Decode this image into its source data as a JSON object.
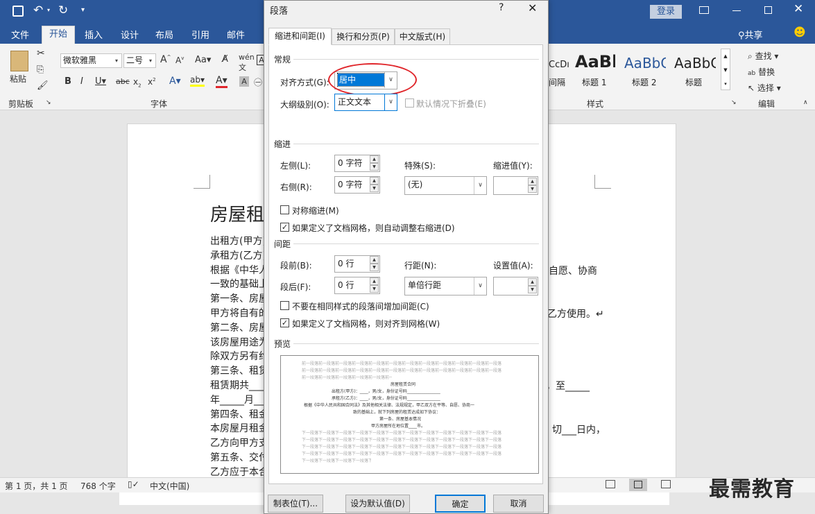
{
  "titlebar": {
    "login": "登录"
  },
  "ribbon_tabs": [
    "文件",
    "开始",
    "插入",
    "设计",
    "布局",
    "引用",
    "邮件"
  ],
  "share": "共享",
  "ribbon": {
    "paste": "粘贴",
    "font_name": "微软雅黑",
    "font_size": "二号",
    "clipboard_group": "剪贴板",
    "font_group": "字体",
    "styles_group": "样式",
    "editing_group": "编辑",
    "styles": [
      {
        "sample": "AaBl",
        "label": "标题 1"
      },
      {
        "sample": "AaBbC",
        "label": "标题 2"
      },
      {
        "sample": "AaBbC",
        "label": "标题"
      }
    ],
    "style_prefix": "CcDı",
    "style_prefix_label": "间隔",
    "find": "查找",
    "replace": "替换",
    "select": "选择"
  },
  "document": {
    "title": "房屋租",
    "lines": [
      "出租方(甲方)",
      "承租方(乙方)",
      "根据《中华人",
      "一致的基础上",
      "第一条、房屋",
      "甲方将自有的",
      "第二条、房屋",
      "该房屋用途为",
      "除双方另有约",
      "第三条、租赁",
      "租赁期共____",
      "年_____月___",
      "第四条、租金",
      "本房屋月租金",
      "乙方向甲方支",
      "第五条、交付",
      "乙方应于本合"
    ],
    "right_texts": [
      "自愿、协商",
      "乙方使用。↵",
      "，至_____",
      "切___日内，"
    ]
  },
  "statusbar": {
    "page": "第 1 页，共 1 页",
    "words": "768 个字",
    "lang": "中文(中国)"
  },
  "watermark": "最需教育",
  "dialog": {
    "title": "段落",
    "help": "?",
    "tabs": [
      "缩进和间距(I)",
      "换行和分页(P)",
      "中文版式(H)"
    ],
    "general": {
      "section": "常规",
      "align_label": "对齐方式(G):",
      "align_value": "居中",
      "outline_label": "大纲级别(O):",
      "outline_value": "正文文本",
      "collapse_label": "默认情况下折叠(E)"
    },
    "indent": {
      "section": "缩进",
      "left_label": "左侧(L):",
      "left_value": "0 字符",
      "right_label": "右侧(R):",
      "right_value": "0 字符",
      "special_label": "特殊(S):",
      "special_value": "(无)",
      "indent_by_label": "缩进值(Y):",
      "indent_by_value": "",
      "mirror_label": "对称缩进(M)",
      "auto_right_label": "如果定义了文档网格，则自动调整右缩进(D)"
    },
    "spacing": {
      "section": "间距",
      "before_label": "段前(B):",
      "before_value": "0 行",
      "after_label": "段后(F):",
      "after_value": "0 行",
      "line_label": "行距(N):",
      "line_value": "单倍行距",
      "at_label": "设置值(A):",
      "at_value": "",
      "no_space_label": "不要在相同样式的段落间增加间距(C)",
      "snap_label": "如果定义了文档网格，则对齐到网格(W)"
    },
    "preview": {
      "section": "预览",
      "prev_para": "前一段落前一段落前一段落前一段落前一段落前一段落前一段落前一段落前一段落前一段落前一段落前一段落",
      "sample_lines": [
        "房屋租赁合同",
        "出租方(甲方)：____，男/女，身份证号码________________",
        "承租方(乙方)：____，男/女，身份证号码________________",
        "根据《中华人民共和国合同法》及其他相关法律、法规规定，甲乙双方在平等、自愿、协商一",
        "致的基础上，就下列房屋的租赁达成如下协议：",
        "第一条、房屋基本情况",
        "甲方房屋所在地位置____市。"
      ],
      "next_para": "下一段落下一段落下一段落下一段落下一段落下一段落下一段落下一段落下一段落下一段落下一段落下一段落"
    },
    "buttons": {
      "tabs": "制表位(T)...",
      "default": "设为默认值(D)",
      "ok": "确定",
      "cancel": "取消"
    }
  },
  "colors": {
    "accent": "#2b579a",
    "highlight": "#0078d7",
    "annotation": "#e0262b"
  }
}
